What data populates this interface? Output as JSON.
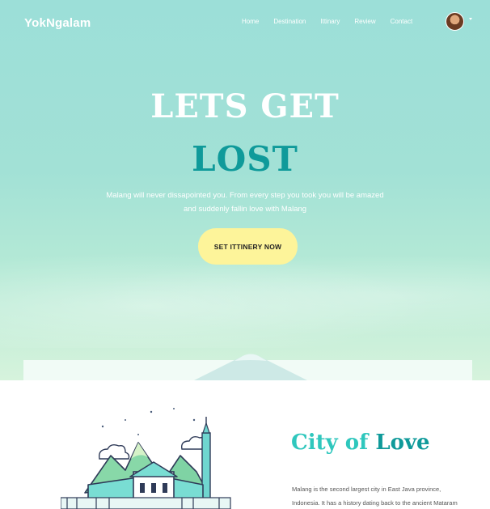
{
  "brand": "YokNgalam",
  "nav": [
    "Home",
    "Destination",
    "Ittinary",
    "Review",
    "Contact"
  ],
  "hero": {
    "title_line1": "LETS GET",
    "title_line2": "LOST",
    "subtitle_line1": "Malang will never dissapointed you. From every step you took you will be amazed",
    "subtitle_line2": "and suddenly fallin love with Malang",
    "cta": "SET ITTINERY NOW"
  },
  "section": {
    "title_part1": "City of ",
    "title_part2": "Love",
    "desc_line1": "Malang is the second largest city in East Java province,",
    "desc_line2": "Indonesia. It has a history dating back to the ancient Mataram"
  },
  "colors": {
    "hero_top": "#9cdfd8",
    "title_accent": "#0f9a9a",
    "title_light": "#2fc7bd",
    "cta_bg": "#fdf49a"
  },
  "icons": [
    "avatar",
    "caret-down-icon",
    "city-illustration",
    "mountain-icon"
  ]
}
